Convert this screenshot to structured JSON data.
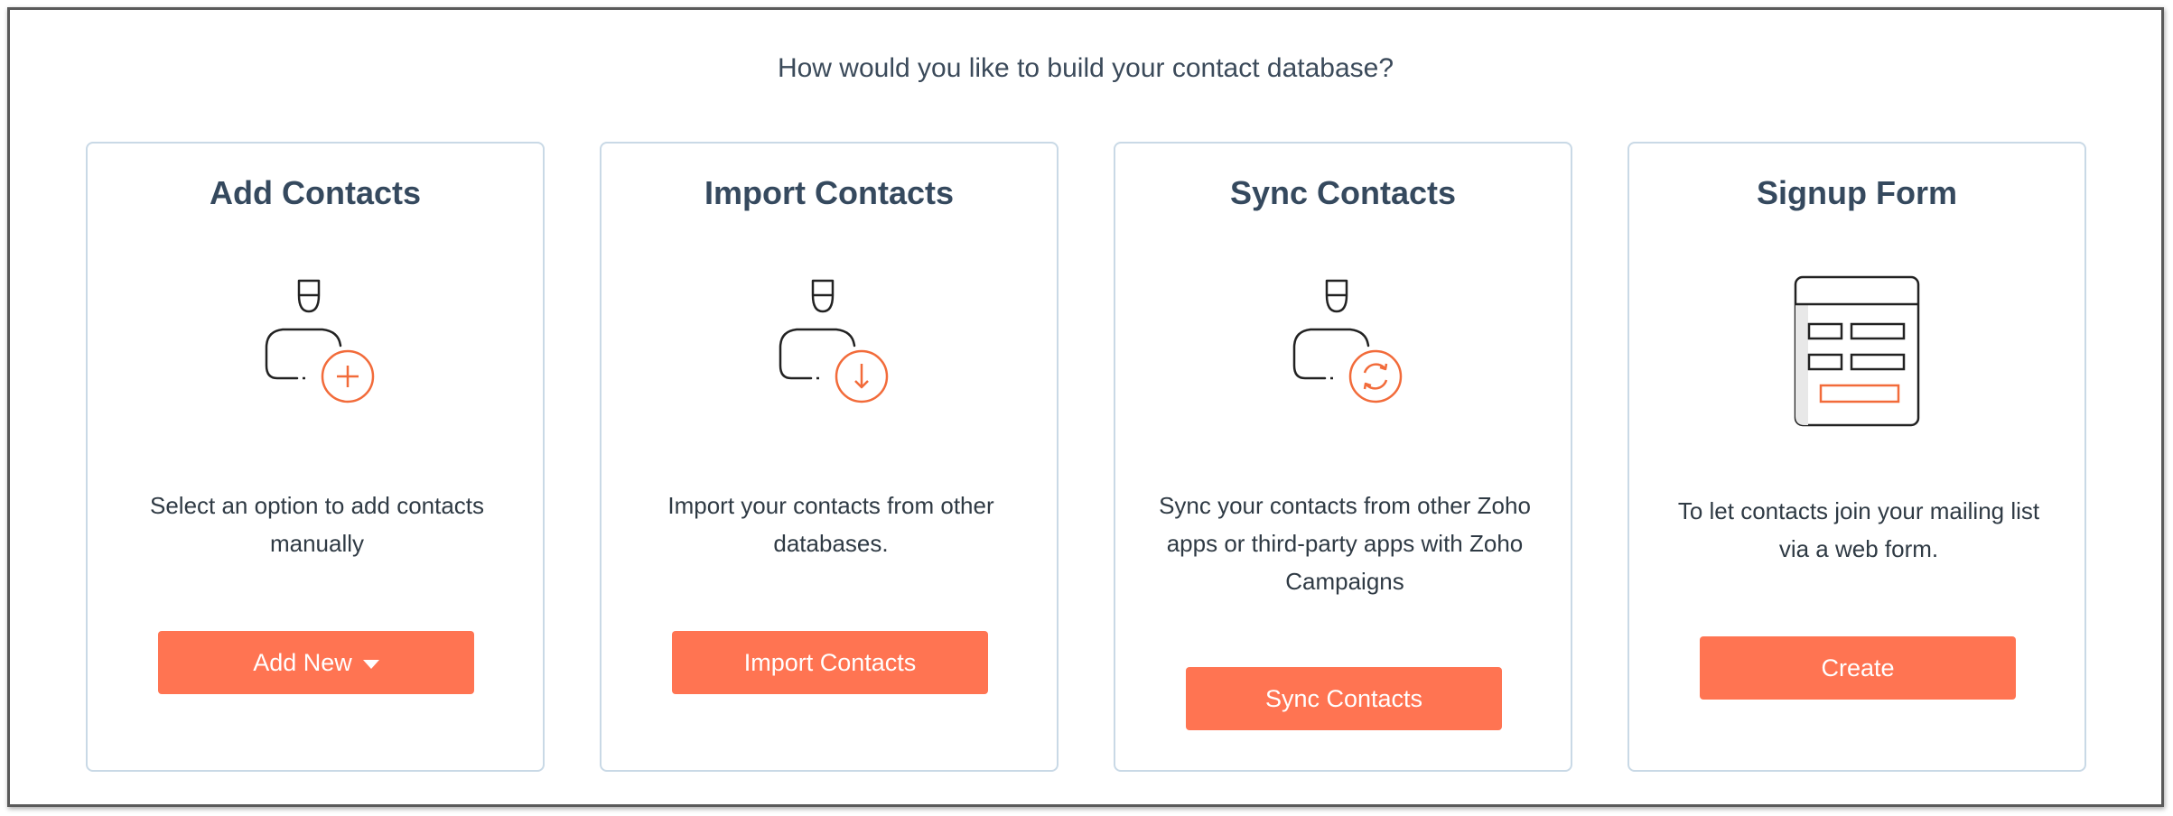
{
  "page": {
    "heading": "How would you like to build your contact database?"
  },
  "cards": [
    {
      "title": "Add Contacts",
      "icon": "person-add-icon",
      "description": "Select an option to add contacts manually",
      "button_label": "Add New"
    },
    {
      "title": "Import Contacts",
      "icon": "person-import-icon",
      "description": "Import your contacts from other databases.",
      "button_label": "Import Contacts"
    },
    {
      "title": "Sync Contacts",
      "icon": "person-sync-icon",
      "description": "Sync your contacts from other Zoho apps or third-party apps with Zoho Campaigns",
      "button_label": "Sync Contacts"
    },
    {
      "title": "Signup Form",
      "icon": "signup-form-icon",
      "description": "To let contacts join your mailing list via a web form.",
      "button_label": "Create"
    }
  ],
  "colors": {
    "accent": "#ff7452",
    "heading": "#35495e",
    "card_border": "#c9d9e6",
    "text": "#2f3a44"
  }
}
